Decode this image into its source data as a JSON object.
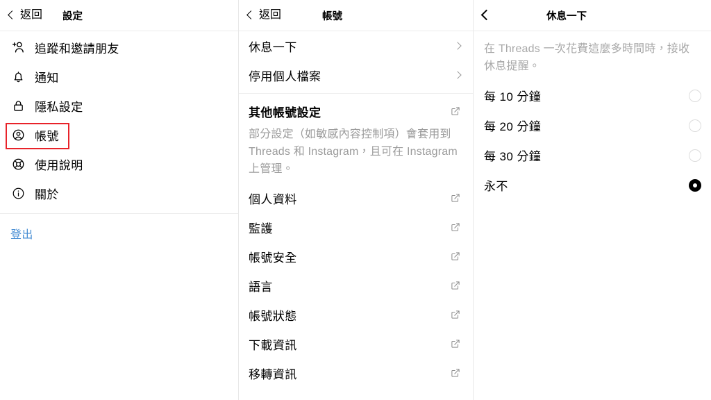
{
  "settings_panel": {
    "back_label": "返回",
    "title": "設定",
    "items": [
      {
        "label": "追蹤和邀請朋友",
        "icon": "person-add-icon"
      },
      {
        "label": "通知",
        "icon": "bell-icon"
      },
      {
        "label": "隱私設定",
        "icon": "lock-icon"
      },
      {
        "label": "帳號",
        "icon": "account-circle-icon",
        "highlighted": true
      },
      {
        "label": "使用說明",
        "icon": "lifebuoy-icon"
      },
      {
        "label": "關於",
        "icon": "info-circle-icon"
      }
    ],
    "logout_label": "登出"
  },
  "account_panel": {
    "back_label": "返回",
    "title": "帳號",
    "items": [
      {
        "label": "休息一下",
        "accessory": "chevron-right-icon",
        "highlighted": true
      },
      {
        "label": "停用個人檔案",
        "accessory": "chevron-right-icon"
      }
    ],
    "other_section": {
      "heading": "其他帳號設定",
      "heading_accessory": "external-link-icon",
      "description": "部分設定（如敏感內容控制項）會套用到 Threads 和 Instagram，且可在 Instagram 上管理。",
      "links": [
        {
          "label": "個人資料",
          "accessory": "external-link-icon"
        },
        {
          "label": "監護",
          "accessory": "external-link-icon"
        },
        {
          "label": "帳號安全",
          "accessory": "external-link-icon"
        },
        {
          "label": "語言",
          "accessory": "external-link-icon"
        },
        {
          "label": "帳號狀態",
          "accessory": "external-link-icon"
        },
        {
          "label": "下載資訊",
          "accessory": "external-link-icon"
        },
        {
          "label": "移轉資訊",
          "accessory": "external-link-icon"
        }
      ]
    }
  },
  "break_panel": {
    "title": "休息一下",
    "description": "在 Threads 一次花費這麼多時間時，接收休息提醒。",
    "options": [
      {
        "label": "每 10 分鐘",
        "selected": false
      },
      {
        "label": "每 20 分鐘",
        "selected": false
      },
      {
        "label": "每 30 分鐘",
        "selected": false
      },
      {
        "label": "永不",
        "selected": true
      }
    ]
  },
  "annotations": {
    "highlight_color": "#e8232a",
    "boxes": [
      {
        "target": "sidebar-item-account"
      },
      {
        "target": "account-item-break"
      }
    ]
  }
}
